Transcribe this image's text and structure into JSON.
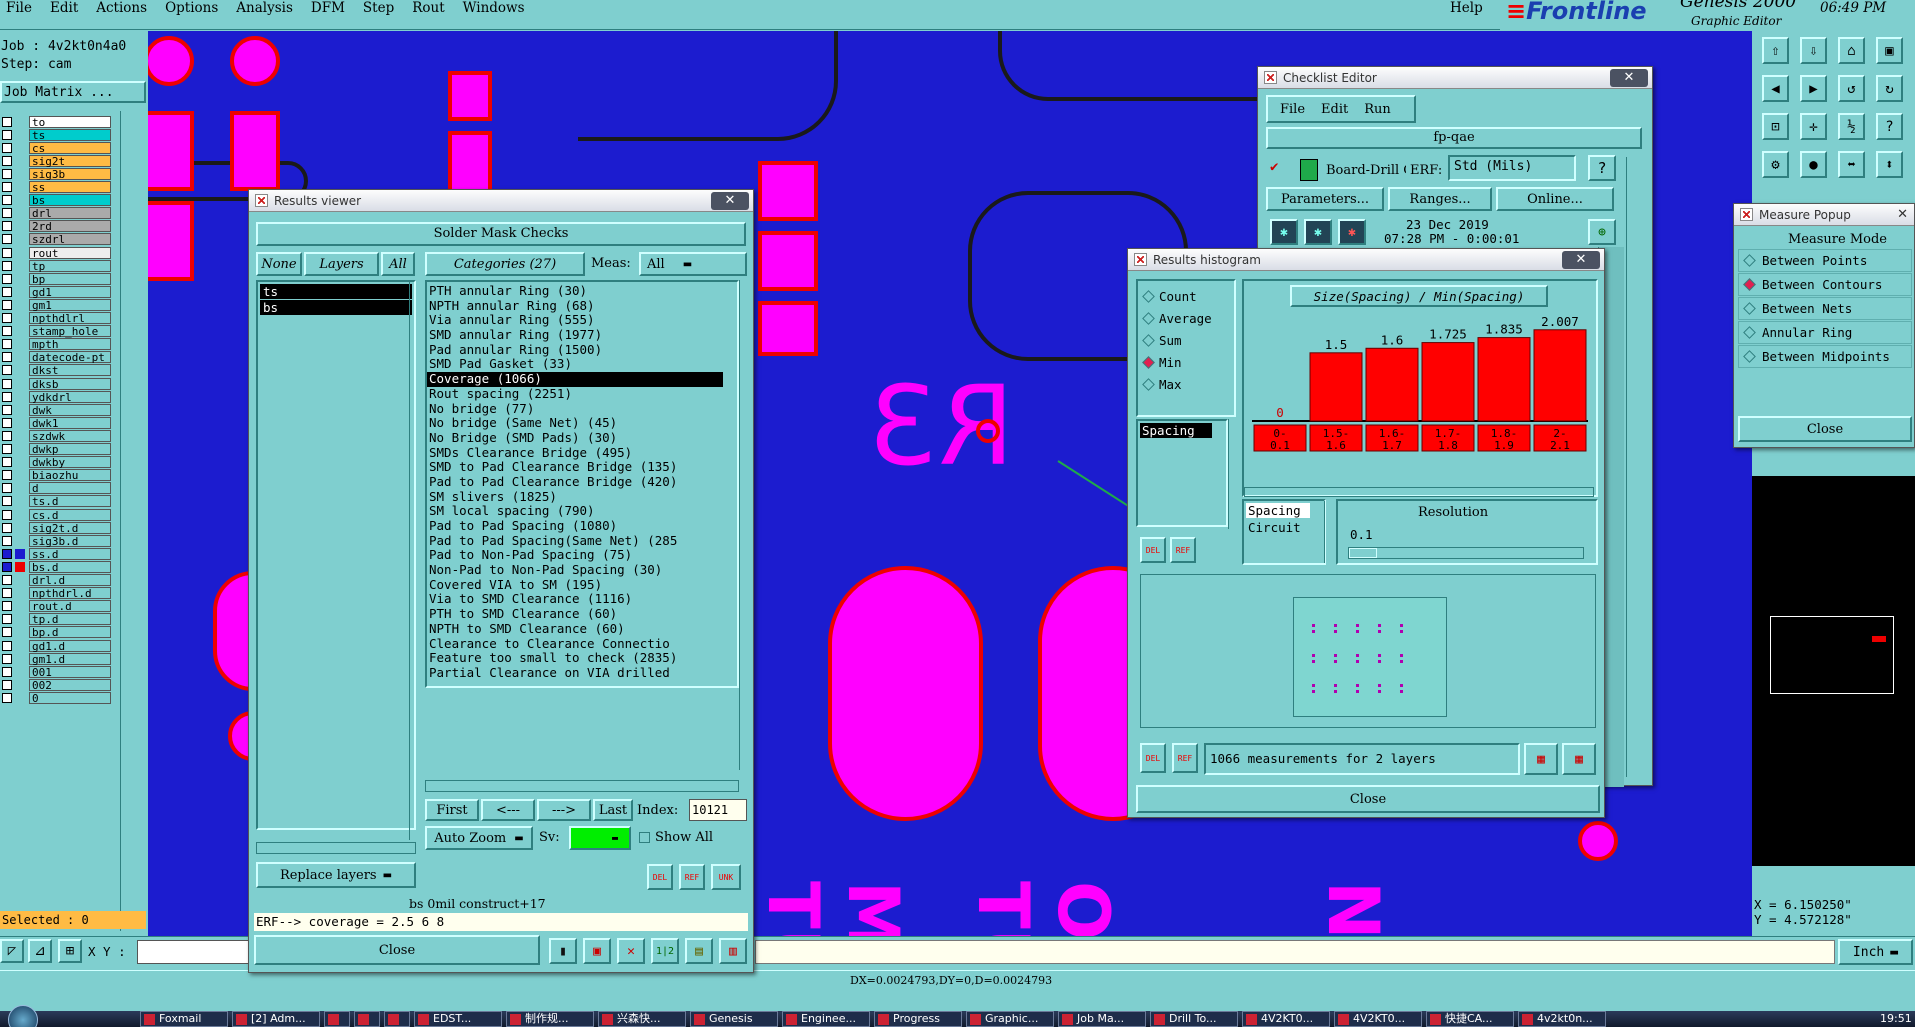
{
  "menu": {
    "items": [
      "File",
      "Edit",
      "Actions",
      "Options",
      "Analysis",
      "DFM",
      "Step",
      "Rout",
      "Windows"
    ],
    "help": "Help"
  },
  "brand": {
    "logo": "Frontline",
    "product": "Genesis 2000",
    "sub": "Graphic Editor",
    "time": "06:49 PM"
  },
  "job": {
    "job_line": "Job : 4v2kt0n4a0",
    "step_line": "Step: cam",
    "matrix_btn": "Job Matrix ..."
  },
  "layers": [
    {
      "name": "to",
      "color": "#ffffff"
    },
    {
      "name": "ts",
      "color": "#00cccc"
    },
    {
      "name": "cs",
      "color": "#ffbb44"
    },
    {
      "name": "sig2t",
      "color": "#ffbb44"
    },
    {
      "name": "sig3b",
      "color": "#ffbb44"
    },
    {
      "name": "ss",
      "color": "#ffbb44"
    },
    {
      "name": "bs",
      "color": "#00cccc"
    },
    {
      "name": "drl",
      "color": "#aaaaaa"
    },
    {
      "name": "2rd",
      "color": "#aaaaaa"
    },
    {
      "name": "szdrl",
      "color": "#aaaaaa"
    },
    {
      "name": "rout",
      "color": "#eeeeee"
    },
    {
      "name": "tp",
      "color": "#7fcfcf"
    },
    {
      "name": "bp",
      "color": "#7fcfcf"
    },
    {
      "name": "gd1",
      "color": "#7fcfcf"
    },
    {
      "name": "gm1",
      "color": "#7fcfcf"
    },
    {
      "name": "npthdlrl",
      "color": "#7fcfcf"
    },
    {
      "name": "stamp_hole",
      "color": "#7fcfcf"
    },
    {
      "name": "mpth",
      "color": "#7fcfcf"
    },
    {
      "name": "datecode-pt",
      "color": "#7fcfcf"
    },
    {
      "name": "dkst",
      "color": "#7fcfcf"
    },
    {
      "name": "dksb",
      "color": "#7fcfcf"
    },
    {
      "name": "ydkdrl",
      "color": "#7fcfcf"
    },
    {
      "name": "dwk",
      "color": "#7fcfcf"
    },
    {
      "name": "dwk1",
      "color": "#7fcfcf"
    },
    {
      "name": "szdwk",
      "color": "#7fcfcf"
    },
    {
      "name": "dwkp",
      "color": "#7fcfcf"
    },
    {
      "name": "dwkby",
      "color": "#7fcfcf"
    },
    {
      "name": "biaozhu",
      "color": "#7fcfcf"
    },
    {
      "name": "d",
      "color": "#7fcfcf"
    },
    {
      "name": "ts.d",
      "color": "#7fcfcf"
    },
    {
      "name": "cs.d",
      "color": "#7fcfcf"
    },
    {
      "name": "sig2t.d",
      "color": "#7fcfcf"
    },
    {
      "name": "sig3b.d",
      "color": "#7fcfcf"
    },
    {
      "name": "ss.d",
      "color": "#7fcfcf"
    },
    {
      "name": "bs.d",
      "color": "#7fcfcf"
    },
    {
      "name": "drl.d",
      "color": "#7fcfcf"
    },
    {
      "name": "npthdrl.d",
      "color": "#7fcfcf"
    },
    {
      "name": "rout.d",
      "color": "#7fcfcf"
    },
    {
      "name": "tp.d",
      "color": "#7fcfcf"
    },
    {
      "name": "bp.d",
      "color": "#7fcfcf"
    },
    {
      "name": "gd1.d",
      "color": "#7fcfcf"
    },
    {
      "name": "gm1.d",
      "color": "#7fcfcf"
    },
    {
      "name": "001",
      "color": "#7fcfcf"
    },
    {
      "name": "002",
      "color": "#7fcfcf"
    },
    {
      "name": "0",
      "color": "#7fcfcf"
    }
  ],
  "selected": "Selected : 0",
  "board_text": {
    "ref": "R3",
    "labels": [
      "TUO",
      "MOC",
      "TUO",
      "O/V",
      "NI"
    ]
  },
  "results_viewer": {
    "title": "Results viewer",
    "header": "Solder Mask Checks",
    "none_btn": "None",
    "layers_btn": "Layers",
    "all_btn": "All",
    "categories_btn": "Categories (27)",
    "meas_label": "Meas:",
    "meas_value": "All",
    "layers": [
      "ts",
      "bs"
    ],
    "categories": [
      "PTH annular Ring (30)",
      "NPTH annular Ring (68)",
      "Via annular Ring (555)",
      "SMD annular Ring (1977)",
      "Pad annular Ring (1500)",
      "SMD Pad Gasket (33)",
      "Coverage (1066)",
      "Rout spacing (2251)",
      "No bridge (77)",
      "No bridge (Same Net) (45)",
      "No Bridge (SMD Pads) (30)",
      "SMDs Clearance Bridge (495)",
      "SMD to Pad Clearance Bridge (135)",
      "Pad to Pad Clearance Bridge (420)",
      "SM slivers (1825)",
      "SM local spacing (790)",
      "Pad to Pad Spacing (1080)",
      "Pad to Pad Spacing(Same Net) (285",
      "Pad to Non-Pad Spacing (75)",
      "Non-Pad to Non-Pad Spacing (30)",
      "Covered VIA to SM (195)",
      "Via to SMD Clearance (1116)",
      "PTH to SMD Clearance (60)",
      "NPTH to SMD Clearance (60)",
      "Clearance to Clearance Connectio",
      "Feature too small to check (2835)",
      "Partial Clearance on VIA drilled"
    ],
    "selected_index": 6,
    "nav": {
      "first": "First",
      "prev": "<---",
      "next": "--->",
      "last": "Last",
      "index_label": "Index:",
      "index_value": "10121"
    },
    "auto_zoom": "Auto Zoom",
    "sv_label": "Sv:",
    "show_all": "Show All",
    "replace_layers": "Replace layers",
    "status": "bs 0mil    construct+17",
    "erf": "ERF--> coverage = 2.5 6 8",
    "close": "Close"
  },
  "checklist": {
    "title": "Checklist Editor",
    "menu": [
      "File",
      "Edit",
      "Run"
    ],
    "name": "fp-qae",
    "row": "Board-Drill Che",
    "erf_label": "ERF:",
    "erf_value": "Std (Mils)",
    "help": "?",
    "params": "Parameters...",
    "ranges": "Ranges...",
    "online": "Online...",
    "date": "23 Dec 2019",
    "time": "07:28 PM - 0:00:01"
  },
  "histogram": {
    "title": "Results histogram",
    "modes": [
      {
        "label": "Count",
        "on": false
      },
      {
        "label": "Average",
        "on": false
      },
      {
        "label": "Sum",
        "on": false
      },
      {
        "label": "Min",
        "on": true
      },
      {
        "label": "Max",
        "on": false
      }
    ],
    "chart_title": "Size(Spacing) / Min(Spacing)",
    "list_item": "Spacing",
    "spacing_label": "Spacing",
    "circuit_label": "Circuit",
    "resolution_label": "Resolution",
    "resolution_value": "0.1",
    "summary": "1066 measurements for 2 layers",
    "close": "Close"
  },
  "chart_data": {
    "type": "bar",
    "title": "Size(Spacing) / Min(Spacing)",
    "categories": [
      "0-0.1",
      "1.5-1.6",
      "1.6-1.7",
      "1.7-1.8",
      "1.8-1.9",
      "2-2.1"
    ],
    "values": [
      0,
      1.5,
      1.6,
      1.725,
      1.835,
      2.007
    ],
    "value_labels": [
      "0",
      "1.5",
      "1.6",
      "1.725",
      "1.835",
      "2.007"
    ],
    "ylim": [
      0,
      2.2
    ],
    "colors": {
      "bar": "#ff0000",
      "plot_bg": "#7fcfcf"
    }
  },
  "measure": {
    "title": "Measure Popup",
    "mode_label": "Measure Mode",
    "options": [
      {
        "label": "Between Points",
        "on": false
      },
      {
        "label": "Between Contours",
        "on": true
      },
      {
        "label": "Between Nets",
        "on": false
      },
      {
        "label": "Annular Ring",
        "on": false
      },
      {
        "label": "Between Midpoints",
        "on": false
      }
    ],
    "close": "Close"
  },
  "coords": {
    "x": "X = 6.150250\"",
    "y": "Y = 4.572128\""
  },
  "bottom": {
    "xy_label": "X Y :",
    "units": "Inch",
    "delta": "DX=0.0024793,DY=0,D=0.0024793"
  },
  "taskbar": {
    "items": [
      "Foxmail",
      "[2] Adm...",
      "",
      "",
      "",
      "EDST...",
      "制作规...",
      "兴森快...",
      "Genesis",
      "Enginee...",
      "Progress",
      "Graphic...",
      "Job Ma...",
      "Drill To...",
      "4V2KT0...",
      "4V2KT0...",
      "快捷CA...",
      "4v2kt0n..."
    ],
    "clock": "19:51"
  }
}
